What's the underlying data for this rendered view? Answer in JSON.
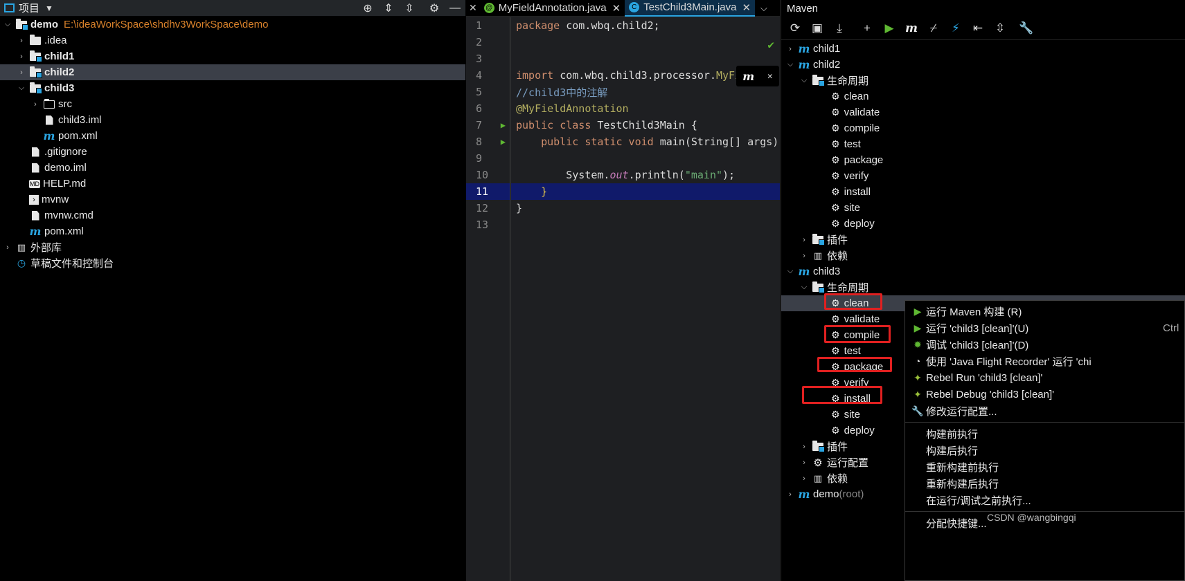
{
  "project": {
    "title": "项目",
    "tree": [
      {
        "label": "demo",
        "path": "E:\\ideaWorkSpace\\shdhv3WorkSpace\\demo"
      },
      {
        "label": ".idea"
      },
      {
        "label": "child1"
      },
      {
        "label": "child2"
      },
      {
        "label": "child3"
      },
      {
        "label": "src"
      },
      {
        "label": "child3.iml"
      },
      {
        "label": "pom.xml"
      },
      {
        "label": ".gitignore"
      },
      {
        "label": "demo.iml"
      },
      {
        "label": "HELP.md"
      },
      {
        "label": "mvnw"
      },
      {
        "label": "mvnw.cmd"
      },
      {
        "label": "pom.xml"
      },
      {
        "label": "外部库"
      },
      {
        "label": "草稿文件和控制台"
      }
    ]
  },
  "editor": {
    "tabs": [
      {
        "label": "MyFieldAnnotation.java"
      },
      {
        "label": "TestChild3Main.java"
      }
    ],
    "line_numbers": [
      "1",
      "2",
      "3",
      "4",
      "5",
      "6",
      "7",
      "8",
      "9",
      "10",
      "11",
      "12",
      "13"
    ],
    "code": {
      "l1_kw": "package",
      "l1_rest": " com.wbq.child2;",
      "l4_kw": "import",
      "l4_rest": " com.wbq.child3.processor.",
      "l4_cls": "MyFieldAnn",
      "l5": "//child3中的注解",
      "l6": "@MyFieldAnnotation",
      "l7_kw": "public class",
      "l7_rest": " TestChild3Main {",
      "l8_kw": "    public static void",
      "l8_rest": " main(String[] args)",
      "l10_pre": "        System.",
      "l10_it": "out",
      "l10_mid": ".println(",
      "l10_str": "\"main\"",
      "l10_end": ");",
      "l11": "    }",
      "l12": "}"
    }
  },
  "maven": {
    "title": "Maven",
    "tree": {
      "child1": "child1",
      "child2": "child2",
      "lifecycle": "生命周期",
      "plugins": "插件",
      "deps": "依赖",
      "child3": "child3",
      "runconfig": "运行配置",
      "demo": "demo",
      "root": " (root)",
      "goals": [
        "clean",
        "validate",
        "compile",
        "test",
        "package",
        "verify",
        "install",
        "site",
        "deploy"
      ]
    }
  },
  "context_menu": {
    "items": [
      {
        "label": "运行 Maven 构建 (R)"
      },
      {
        "label": "运行 'child3 [clean]'(U)",
        "shortcut": "Ctrl"
      },
      {
        "label": "调试 'child3 [clean]'(D)"
      },
      {
        "label": "使用 'Java Flight Recorder' 运行 'chi"
      },
      {
        "label": "Rebel Run 'child3 [clean]'"
      },
      {
        "label": "Rebel Debug 'child3 [clean]'"
      },
      {
        "label": "修改运行配置..."
      },
      {
        "label": "构建前执行"
      },
      {
        "label": "构建后执行"
      },
      {
        "label": "重新构建前执行"
      },
      {
        "label": "重新构建后执行"
      },
      {
        "label": "在运行/调试之前执行..."
      },
      {
        "label": "分配快捷键..."
      }
    ]
  },
  "watermark": "CSDN @wangbingqi",
  "colors": {
    "accent": "#2aa5e2",
    "path": "#d9822b",
    "highlight": "#e02020",
    "current_line": "#101a6a"
  }
}
